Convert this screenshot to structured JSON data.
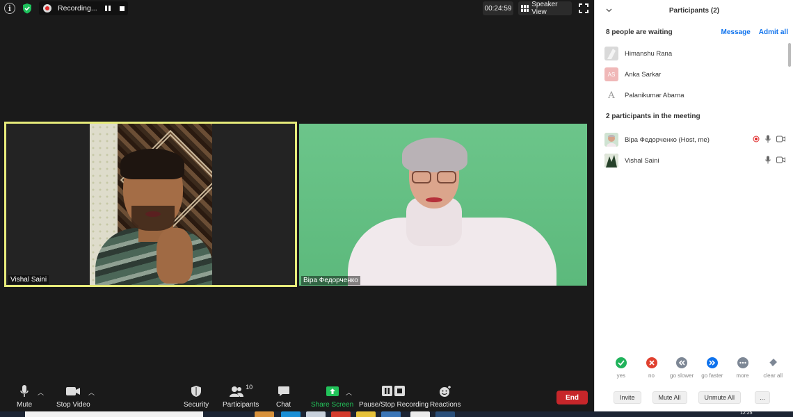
{
  "topbar": {
    "recording_label": "Recording...",
    "timer": "00:24:59",
    "view_label": "Speaker View"
  },
  "tiles": [
    {
      "name": "Vishal Saini"
    },
    {
      "name": "Віра Федорченко"
    }
  ],
  "toolbar": {
    "mute": "Mute",
    "stop_video": "Stop Video",
    "security": "Security",
    "participants": "Participants",
    "participants_count": "10",
    "chat": "Chat",
    "share_screen": "Share Screen",
    "recording": "Pause/Stop Recording",
    "reactions": "Reactions",
    "end": "End"
  },
  "panel": {
    "title": "Participants (2)",
    "waiting_title": "8 people are waiting",
    "message": "Message",
    "admit_all": "Admit all",
    "waiting": [
      {
        "name": "Himanshu Rana",
        "avatar": ""
      },
      {
        "name": "Anka Sarkar",
        "avatar": "AS"
      },
      {
        "name": "Palanikumar Abarna",
        "avatar": "A"
      }
    ],
    "in_meeting_title": "2 participants in the meeting",
    "in_meeting": [
      {
        "name": "Віра Федорченко (Host, me)"
      },
      {
        "name": "Vishal Saini"
      }
    ],
    "nonverbal": [
      {
        "label": "yes",
        "color": "#21b35c"
      },
      {
        "label": "no",
        "color": "#e0412f"
      },
      {
        "label": "go slower",
        "color": "#7d8795"
      },
      {
        "label": "go faster",
        "color": "#0e72ed"
      },
      {
        "label": "more",
        "color": "#7d8795"
      },
      {
        "label": "clear all",
        "color": "#7d8795"
      }
    ],
    "footer": {
      "invite": "Invite",
      "mute_all": "Mute All",
      "unmute_all": "Unmute All",
      "more": "..."
    }
  },
  "taskbar": {
    "clock": "12:25"
  },
  "colors": {
    "accent_blue": "#0e72ed",
    "end_red": "#c7262a",
    "active_speaker": "#e6ea7a",
    "share_green": "#22c35a"
  }
}
